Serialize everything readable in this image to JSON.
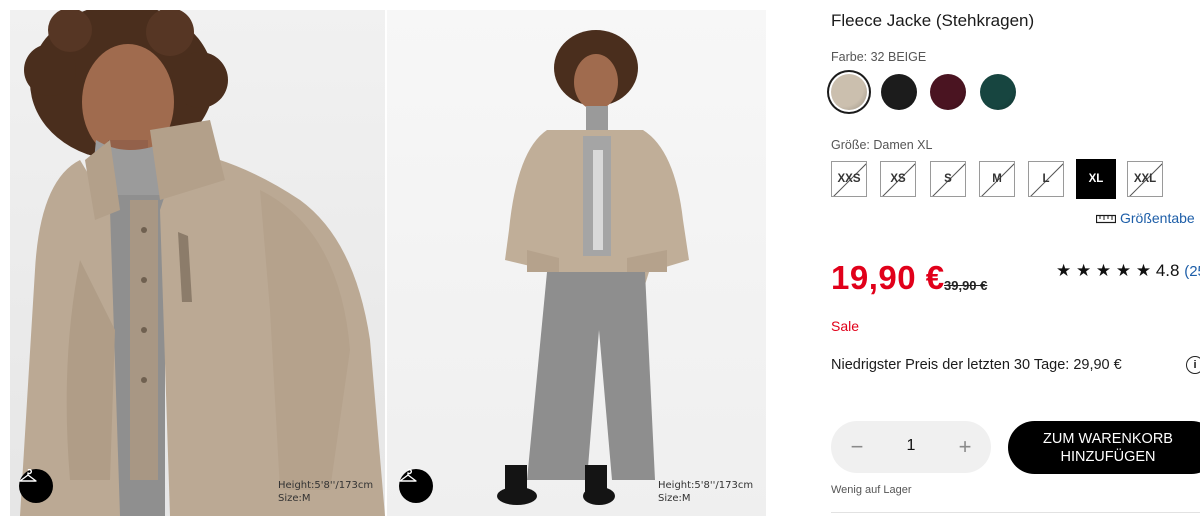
{
  "gallery": {
    "model_button_icon": "hanger-icon",
    "images": [
      {
        "alt": "model-closeup",
        "model_height": "Height:5'8''/173cm",
        "model_size": "Size:M"
      },
      {
        "alt": "model-fullbody",
        "model_height": "Height:5'8''/173cm",
        "model_size": "Size:M"
      }
    ]
  },
  "product": {
    "title": "Fleece Jacke (Stehkragen)",
    "color_label": "Farbe: 32 BEIGE",
    "colors": [
      {
        "name": "beige",
        "hex": "#cbbfae",
        "selected": true
      },
      {
        "name": "black",
        "hex": "#1c1c1c",
        "selected": false
      },
      {
        "name": "wine",
        "hex": "#4a1421",
        "selected": false
      },
      {
        "name": "green",
        "hex": "#174540",
        "selected": false
      }
    ],
    "size_label": "Größe: Damen XL",
    "sizes": [
      {
        "label": "XXS",
        "available": false,
        "selected": false
      },
      {
        "label": "XS",
        "available": false,
        "selected": false
      },
      {
        "label": "S",
        "available": false,
        "selected": false
      },
      {
        "label": "M",
        "available": false,
        "selected": false
      },
      {
        "label": "L",
        "available": false,
        "selected": false
      },
      {
        "label": "XL",
        "available": true,
        "selected": true
      },
      {
        "label": "XXL",
        "available": false,
        "selected": false
      }
    ],
    "size_guide_label": "Größentabe",
    "price": "19,90 €",
    "old_price": "39,90 €",
    "rating_stars": "★ ★ ★ ★ ★",
    "rating_value": "4.8",
    "rating_count": "(25",
    "sale_label": "Sale",
    "lowest_price_text": "Niedrigster Preis der letzten 30 Tage: 29,90 €",
    "info_icon": "i",
    "quantity": "1",
    "minus": "−",
    "plus": "+",
    "add_to_cart": "ZUM WARENKORB HINZUFÜGEN",
    "stock_text": "Wenig auf Lager"
  },
  "colors": {
    "sale_red": "#e1001a",
    "link_blue": "#1d5ea8"
  }
}
